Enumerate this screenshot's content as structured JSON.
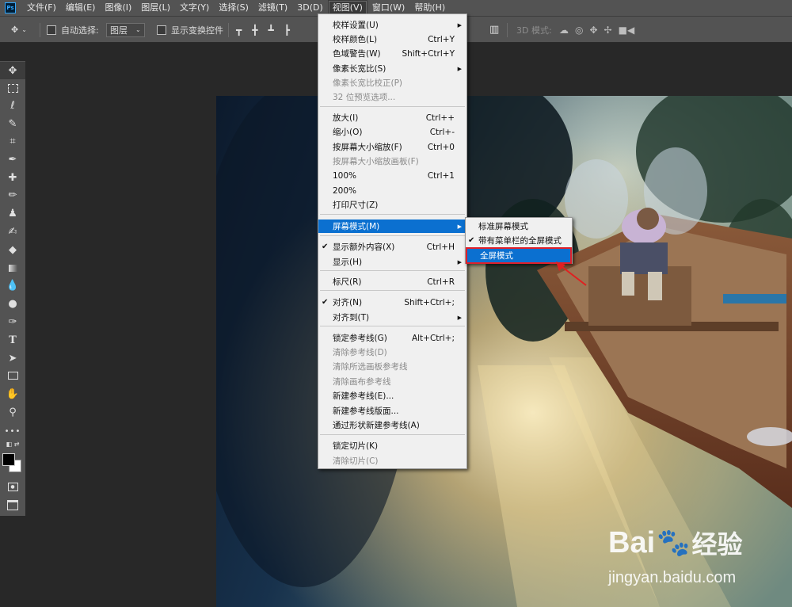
{
  "app": {
    "logo_text": "Ps"
  },
  "menubar": {
    "items": [
      "文件(F)",
      "编辑(E)",
      "图像(I)",
      "图层(L)",
      "文字(Y)",
      "选择(S)",
      "滤镜(T)",
      "3D(D)",
      "视图(V)",
      "窗口(W)",
      "帮助(H)"
    ],
    "active": "视图(V)"
  },
  "options": {
    "auto_select_label": "自动选择:",
    "layer_select_value": "图层",
    "show_transform_label": "显示变换控件",
    "mode_3d_label": "3D 模式:"
  },
  "view_menu": {
    "items": [
      {
        "label": "校样设置(U)",
        "shortcut": "",
        "submenu": true
      },
      {
        "label": "校样颜色(L)",
        "shortcut": "Ctrl+Y"
      },
      {
        "label": "色域警告(W)",
        "shortcut": "Shift+Ctrl+Y"
      },
      {
        "label": "像素长宽比(S)",
        "shortcut": "",
        "submenu": true
      },
      {
        "label": "像素长宽比校正(P)",
        "shortcut": "",
        "disabled": true
      },
      {
        "label": "32 位预览选项...",
        "shortcut": "",
        "disabled": true
      },
      {
        "label": "放大(I)",
        "shortcut": "Ctrl++"
      },
      {
        "label": "缩小(O)",
        "shortcut": "Ctrl+-"
      },
      {
        "label": "按屏幕大小缩放(F)",
        "shortcut": "Ctrl+0"
      },
      {
        "label": "按屏幕大小缩放画板(F)",
        "shortcut": "",
        "disabled": true
      },
      {
        "label": "100%",
        "shortcut": "Ctrl+1"
      },
      {
        "label": "200%",
        "shortcut": ""
      },
      {
        "label": "打印尺寸(Z)",
        "shortcut": ""
      },
      {
        "label": "屏幕模式(M)",
        "shortcut": "",
        "submenu": true,
        "highlighted": true
      },
      {
        "label": "显示额外内容(X)",
        "shortcut": "Ctrl+H",
        "checked": true
      },
      {
        "label": "显示(H)",
        "shortcut": "",
        "submenu": true
      },
      {
        "label": "标尺(R)",
        "shortcut": "Ctrl+R"
      },
      {
        "label": "对齐(N)",
        "shortcut": "Shift+Ctrl+;",
        "checked": true
      },
      {
        "label": "对齐到(T)",
        "shortcut": "",
        "submenu": true
      },
      {
        "label": "锁定参考线(G)",
        "shortcut": "Alt+Ctrl+;"
      },
      {
        "label": "清除参考线(D)",
        "shortcut": "",
        "disabled": true
      },
      {
        "label": "清除所选画板参考线",
        "shortcut": "",
        "disabled": true
      },
      {
        "label": "清除画布参考线",
        "shortcut": "",
        "disabled": true
      },
      {
        "label": "新建参考线(E)...",
        "shortcut": ""
      },
      {
        "label": "新建参考线版面...",
        "shortcut": ""
      },
      {
        "label": "通过形状新建参考线(A)",
        "shortcut": ""
      },
      {
        "label": "锁定切片(K)",
        "shortcut": ""
      },
      {
        "label": "清除切片(C)",
        "shortcut": "",
        "disabled": true
      }
    ]
  },
  "screen_mode_submenu": {
    "items": [
      {
        "label": "标准屏幕模式"
      },
      {
        "label": "带有菜单栏的全屏模式",
        "checked": true
      },
      {
        "label": "全屏模式",
        "highlighted": true
      }
    ]
  },
  "watermark": {
    "brand": "Bai",
    "brand_suffix": "经验",
    "url": "jingyan.baidu.com"
  }
}
